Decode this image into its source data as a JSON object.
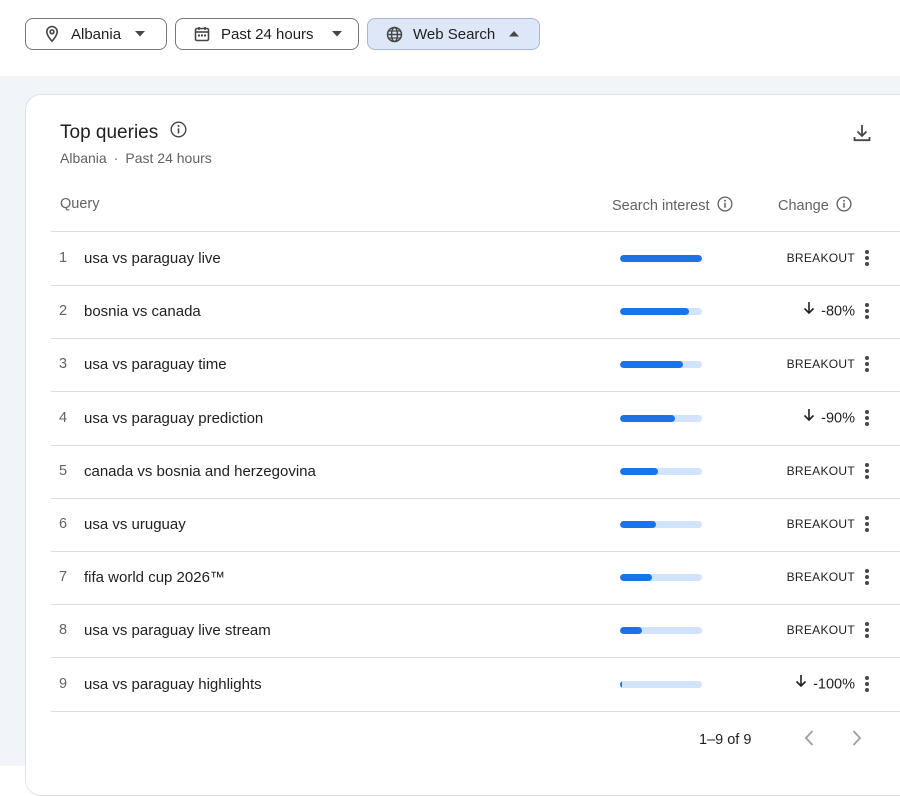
{
  "filters": {
    "location": "Albania",
    "time": "Past 24 hours",
    "type": "Web Search"
  },
  "card": {
    "title": "Top queries",
    "sub_location": "Albania",
    "sub_separator": "·",
    "sub_time": "Past 24 hours"
  },
  "table": {
    "col_query": "Query",
    "col_interest": "Search interest",
    "col_change": "Change",
    "rows": [
      {
        "num": "1",
        "query": "usa vs paraguay live",
        "interest": 1.0,
        "change": "BREAKOUT",
        "down": false
      },
      {
        "num": "2",
        "query": "bosnia vs canada",
        "interest": 0.84,
        "change": "-80%",
        "down": true
      },
      {
        "num": "3",
        "query": "usa vs paraguay time",
        "interest": 0.77,
        "change": "BREAKOUT",
        "down": false
      },
      {
        "num": "4",
        "query": "usa vs paraguay prediction",
        "interest": 0.67,
        "change": "-90%",
        "down": true
      },
      {
        "num": "5",
        "query": "canada vs bosnia and herzegovina",
        "interest": 0.46,
        "change": "BREAKOUT",
        "down": false
      },
      {
        "num": "6",
        "query": "usa vs uruguay",
        "interest": 0.44,
        "change": "BREAKOUT",
        "down": false
      },
      {
        "num": "7",
        "query": "fifa world cup 2026™",
        "interest": 0.39,
        "change": "BREAKOUT",
        "down": false
      },
      {
        "num": "8",
        "query": "usa vs paraguay live stream",
        "interest": 0.27,
        "change": "BREAKOUT",
        "down": false
      },
      {
        "num": "9",
        "query": "usa vs paraguay highlights",
        "interest": 0.02,
        "change": "-100%",
        "down": true
      }
    ]
  },
  "pagination": {
    "label": "1–9 of 9"
  },
  "colors": {
    "accent": "#1a73e8",
    "bar_track": "#d2e3fc",
    "chip_active": "#dde7f7"
  }
}
